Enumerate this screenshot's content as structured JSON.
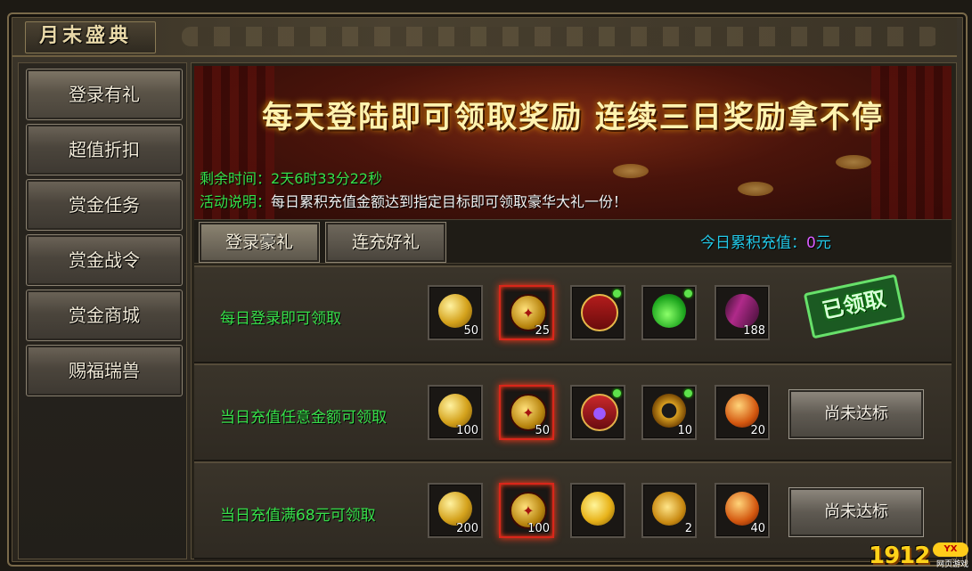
{
  "window": {
    "title": "月末盛典"
  },
  "sidebar": {
    "items": [
      {
        "label": "登录有礼",
        "active": true
      },
      {
        "label": "超值折扣"
      },
      {
        "label": "赏金任务"
      },
      {
        "label": "赏金战令"
      },
      {
        "label": "赏金商城"
      },
      {
        "label": "赐福瑞兽"
      }
    ]
  },
  "banner": {
    "headline": "每天登陆即可领取奖励 连续三日奖励拿不停",
    "remaining_label": "剩余时间：",
    "remaining_value": "2天6时33分22秒",
    "desc_label": "活动说明：",
    "desc_value": "每日累积充值金额达到指定目标即可领取豪华大礼一份！"
  },
  "tabs": [
    {
      "label": "登录豪礼",
      "active": true
    },
    {
      "label": "连充好礼"
    }
  ],
  "recharge": {
    "label": "今日累积充值：",
    "amount": "0",
    "unit": "元"
  },
  "rows": [
    {
      "label": "每日登录即可领取",
      "status": "已领取",
      "items": [
        {
          "icon": "coins-icon",
          "count": "50"
        },
        {
          "icon": "medal-icon",
          "count": "25",
          "highlight": true
        },
        {
          "icon": "chest-icon",
          "count": "",
          "dot": true
        },
        {
          "icon": "potion-icon",
          "count": "",
          "dot": true
        },
        {
          "icon": "wing-icon",
          "count": "188"
        }
      ]
    },
    {
      "label": "当日充值任意金额可领取",
      "button": "尚未达标",
      "items": [
        {
          "icon": "coins-icon",
          "count": "100"
        },
        {
          "icon": "medal-icon",
          "count": "50",
          "highlight": true
        },
        {
          "icon": "gift-icon",
          "count": "",
          "dot": true
        },
        {
          "icon": "ring-icon",
          "count": "10",
          "dot": true
        },
        {
          "icon": "egg-icon",
          "count": "20"
        }
      ]
    },
    {
      "label": "当日充值满68元可领取",
      "button": "尚未达标",
      "items": [
        {
          "icon": "coins-icon",
          "count": "200"
        },
        {
          "icon": "medal-icon",
          "count": "100",
          "highlight": true
        },
        {
          "icon": "gold-ingot-icon",
          "count": ""
        },
        {
          "icon": "gold-bull-icon",
          "count": "2"
        },
        {
          "icon": "egg-icon",
          "count": "40"
        }
      ]
    }
  ],
  "watermark": {
    "digits": "1912",
    "badge": "YX",
    "sub": "网页游戏"
  },
  "colors": {
    "accent_green": "#37e04a",
    "accent_cyan": "#23c9e8",
    "accent_purple": "#d85cff",
    "gold": "#fff3b0"
  }
}
